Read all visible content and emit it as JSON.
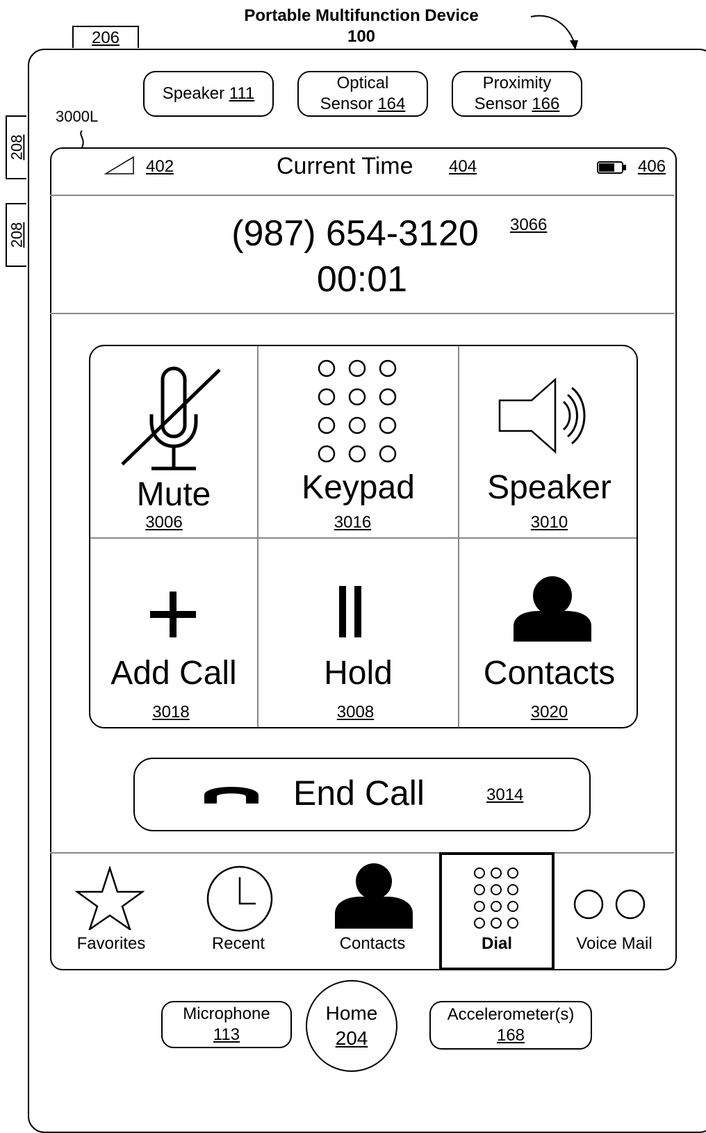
{
  "figure": {
    "title_line1": "Portable Multifunction Device",
    "title_line2": "100",
    "ref_206": "206",
    "ref_208_a": "208",
    "ref_208_b": "208",
    "screen_ref": "3000L"
  },
  "hardware": {
    "speaker": {
      "label": "Speaker",
      "ref": "111"
    },
    "optical": {
      "line1": "Optical",
      "label": "Sensor",
      "ref": "164"
    },
    "proximity": {
      "line1": "Proximity",
      "label": "Sensor",
      "ref": "166"
    },
    "microphone": {
      "label": "Microphone",
      "ref": "113"
    },
    "home": {
      "label": "Home",
      "ref": "204"
    },
    "accelerometer": {
      "label": "Accelerometer(s)",
      "ref": "168"
    }
  },
  "status_bar": {
    "signal_ref": "402",
    "time_label": "Current Time",
    "time_ref": "404",
    "battery_ref": "406"
  },
  "call": {
    "number": "(987) 654-3120",
    "number_ref": "3066",
    "duration": "00:01"
  },
  "controls": {
    "mute": {
      "label": "Mute",
      "ref": "3006",
      "icon": "microphone-muted-icon"
    },
    "keypad": {
      "label": "Keypad",
      "ref": "3016",
      "icon": "keypad-icon"
    },
    "speaker": {
      "label": "Speaker",
      "ref": "3010",
      "icon": "speaker-icon"
    },
    "add_call": {
      "label": "Add Call",
      "ref": "3018",
      "icon": "plus-icon"
    },
    "hold": {
      "label": "Hold",
      "ref": "3008",
      "icon": "pause-icon"
    },
    "contacts": {
      "label": "Contacts",
      "ref": "3020",
      "icon": "person-icon"
    }
  },
  "end_call": {
    "label": "End Call",
    "ref": "3014",
    "icon": "handset-icon"
  },
  "tabs": {
    "favorites": {
      "label": "Favorites",
      "icon": "star-icon"
    },
    "recent": {
      "label": "Recent",
      "icon": "clock-icon"
    },
    "contacts": {
      "label": "Contacts",
      "icon": "person-icon"
    },
    "dial": {
      "label": "Dial",
      "icon": "keypad-icon",
      "active": true
    },
    "voicemail": {
      "label": "Voice Mail",
      "icon": "voicemail-icon"
    }
  }
}
